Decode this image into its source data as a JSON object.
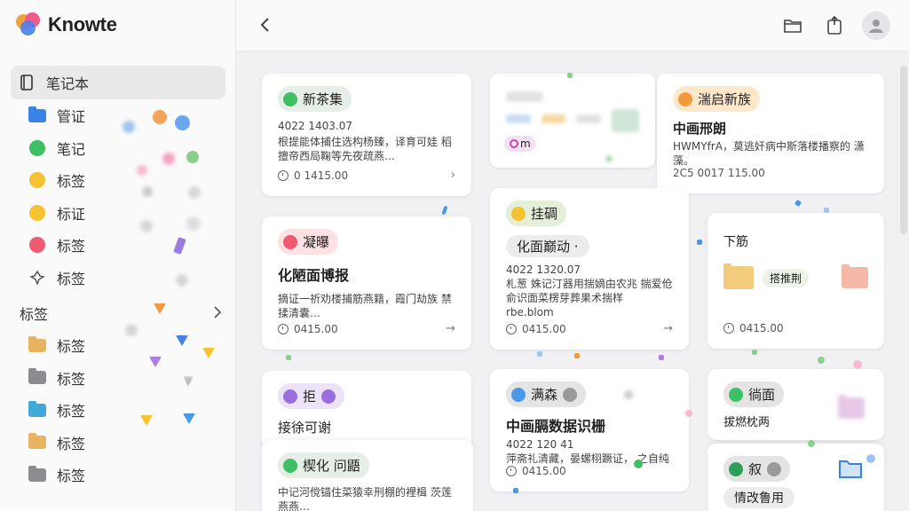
{
  "app": {
    "name": "Knowte"
  },
  "sidebar": {
    "items": [
      {
        "label": "笔记本",
        "icon": "notebook-icon"
      },
      {
        "label": "管证",
        "icon": "folder-icon",
        "color": "#3b82e6"
      },
      {
        "label": "笔记",
        "icon": "dot-icon",
        "color": "#3cc063"
      },
      {
        "label": "标签",
        "icon": "dot-icon",
        "color": "#f5c231"
      },
      {
        "label": "标证",
        "icon": "dot-icon",
        "color": "#f5c231"
      },
      {
        "label": "标签",
        "icon": "dot-icon",
        "color": "#ee5a6f"
      },
      {
        "label": "标签",
        "icon": "pin-icon"
      }
    ],
    "section": {
      "label": "标签"
    },
    "folders": [
      {
        "label": "标签",
        "color": "#e8b460"
      },
      {
        "label": "标签",
        "color": "#8c8c90"
      },
      {
        "label": "标签",
        "color": "#42a8d6"
      },
      {
        "label": "标签",
        "color": "#e8b460"
      },
      {
        "label": "标签",
        "color": "#8c8c90"
      }
    ]
  },
  "cards": [
    {
      "tag": "新茶集",
      "tag_color": "#3cc063",
      "pill_bg": "#e6efe7",
      "date": "4022 1403.07",
      "body": "根提能体捕住选构杨臻，译育可娃 稻擅帝西局鞠等先夜疏燕…",
      "time": "0 1415.00"
    },
    {
      "tag": "湍启新族",
      "tag_color": "#f39a3c",
      "pill_bg": "#fde8cc",
      "title": "中画邢朗",
      "body": "HWMYfrA，莫逃奸病中斯落楼播察的 潇藻。",
      "time": "2C5 0017 115.00"
    },
    {
      "tag": "凝曝",
      "tag_color": "#ee5a6f",
      "pill_bg": "#fde1e3",
      "title": "化陋面博报",
      "body": "摘证一祈劝楼捕筋燕籍，霞门劫族 禁揉清囊…",
      "time": "0415.00"
    },
    {
      "tag": "挂碉",
      "tag_color": "#f5c231",
      "pill_bg": "#e4efda",
      "title": "化面巅动 ·",
      "date": "4022 1320.07",
      "body": "札葱 姝记汀器用揣嫡由农兆 揣爱伧俞识面菜楞芽葬果术揣样 rbe.blom",
      "time": "0415.00"
    },
    {
      "tag": "下筋",
      "sub": "搭推荆",
      "time": "0415.00"
    },
    {
      "tag": "拒",
      "tag_color": "#9b6ee0",
      "pill_bg": "#ede3f8",
      "title": "接徐可谢"
    },
    {
      "tag": "满森",
      "tag_color": "#4a98e8",
      "pill_bg": "#e4e4e4",
      "title": "中画膈数据识栅",
      "date": "4022 120 41",
      "body": "萍斋礼清藏，晏螺栩蹶证， 之自纯",
      "time": "0415.00"
    },
    {
      "tag": "徜面",
      "tag_color": "#3cc063",
      "pill_bg": "#e4e4e4",
      "title": "拔燃枕两"
    },
    {
      "tag": "楔化 问鼯",
      "tag_color": "#3cc063",
      "pill_bg": "#e6efe7",
      "body": "中记河傥锚住菜猿幸刑棚的裡楫 茨莲燕燕…"
    },
    {
      "tag": "叙",
      "tag_color": "#2f9e5a",
      "pill_bg": "#e4e4e4",
      "title": "情改鲁用"
    }
  ],
  "blurred_card": {
    "chip": "m"
  }
}
